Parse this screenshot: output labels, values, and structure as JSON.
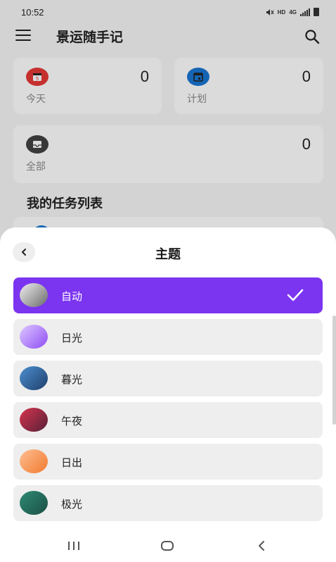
{
  "status_bar": {
    "time": "10:52",
    "hd": "HD",
    "network": "4G"
  },
  "app": {
    "title": "景运随手记"
  },
  "cards": {
    "today": {
      "label": "今天",
      "count": "0",
      "color": "#e53935"
    },
    "plan": {
      "label": "计划",
      "count": "0",
      "color": "#1976d2"
    },
    "all": {
      "label": "全部",
      "count": "0",
      "color": "#424242"
    }
  },
  "section": {
    "title": "我的任务列表"
  },
  "sheet": {
    "title": "主题",
    "themes": [
      {
        "label": "自动",
        "selected": true,
        "gradient": [
          "#f0f0f0",
          "#6a6a6a"
        ]
      },
      {
        "label": "日光",
        "selected": false,
        "gradient": [
          "#ddc8ff",
          "#8f4df5"
        ]
      },
      {
        "label": "暮光",
        "selected": false,
        "gradient": [
          "#4d8fd0",
          "#1e3f6b"
        ]
      },
      {
        "label": "午夜",
        "selected": false,
        "gradient": [
          "#d8344e",
          "#552038"
        ]
      },
      {
        "label": "日出",
        "selected": false,
        "gradient": [
          "#ffbe93",
          "#f07a2e"
        ]
      },
      {
        "label": "极光",
        "selected": false,
        "gradient": [
          "#2f8a75",
          "#1a4f44"
        ]
      }
    ],
    "accent": "#7b34f0"
  }
}
